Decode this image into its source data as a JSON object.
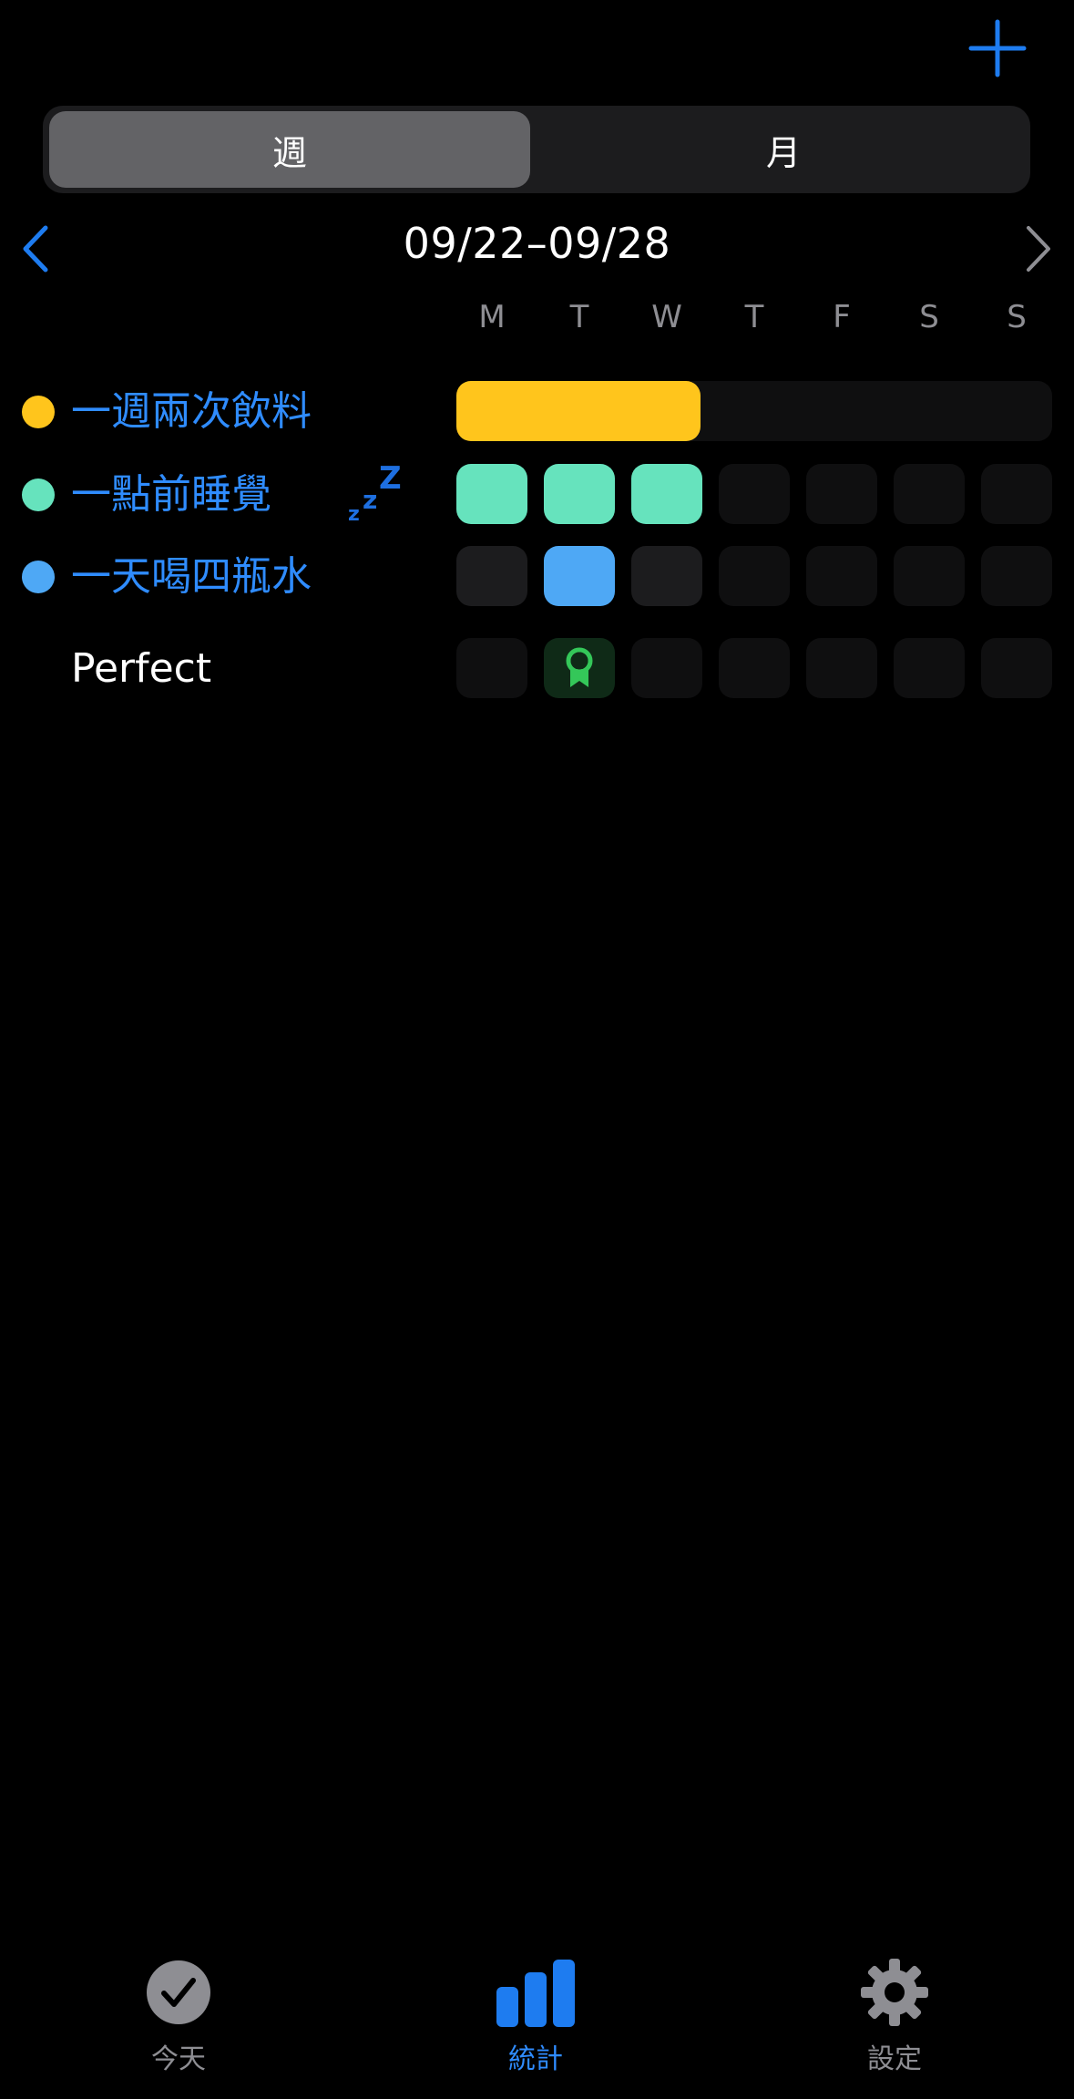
{
  "header": {
    "add_icon": "plus-icon"
  },
  "segments": {
    "week_label": "週",
    "month_label": "月",
    "selected": "week"
  },
  "date_nav": {
    "range": "09/22–09/28",
    "prev_icon": "chevron-left-icon",
    "next_icon": "chevron-right-icon"
  },
  "weekdays": [
    "M",
    "T",
    "W",
    "T",
    "F",
    "S",
    "S"
  ],
  "habits": [
    {
      "name": "一週兩次飲料",
      "color": "#ffc51c",
      "display": "weekly-bar",
      "progress": 0.41
    },
    {
      "name": "一點前睡覺",
      "suffix": "zzZ",
      "color": "#66e3bd",
      "display": "daily",
      "done": [
        true,
        true,
        true,
        false,
        false,
        false,
        false
      ]
    },
    {
      "name": "一天喝四瓶水",
      "color": "#4ea8f5",
      "display": "daily",
      "done": [
        false,
        true,
        false,
        false,
        false,
        false,
        false
      ]
    }
  ],
  "perfect": {
    "label": "Perfect",
    "days": [
      false,
      true,
      false,
      false,
      false,
      false,
      false
    ],
    "icon": "award-ribbon-icon",
    "accent": "#34c759"
  },
  "tabbar": {
    "today_label": "今天",
    "stats_label": "統計",
    "settings_label": "設定",
    "active": "stats",
    "accent": "#2f8cff"
  }
}
